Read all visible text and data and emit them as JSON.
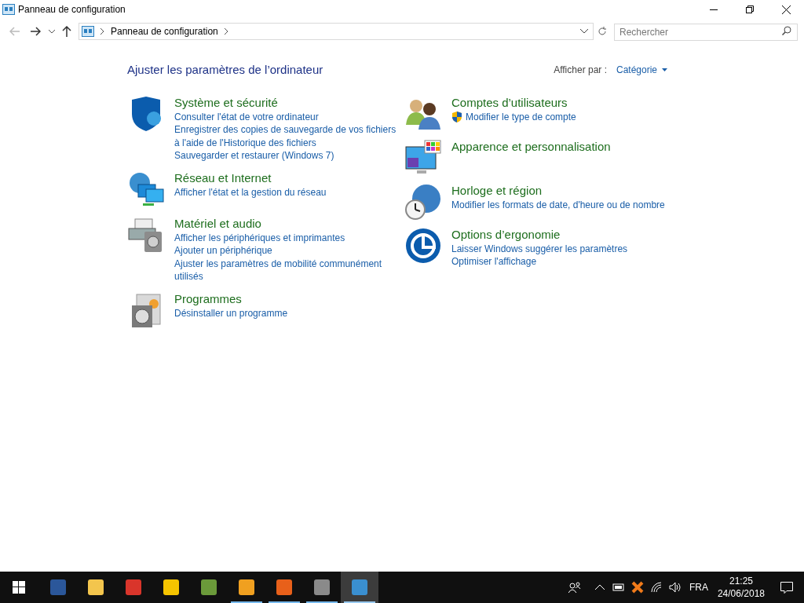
{
  "window": {
    "title": "Panneau de configuration"
  },
  "address_bar": {
    "crumbs": [
      "Panneau de configuration"
    ]
  },
  "search": {
    "placeholder": "Rechercher"
  },
  "heading": "Ajuster les paramètres de l’ordinateur",
  "view_by": {
    "label": "Afficher par :",
    "value": "Catégorie"
  },
  "columns": [
    [
      {
        "title": "Système et sécurité",
        "links": [
          {
            "text": "Consulter l'état de votre ordinateur",
            "kind": "plain"
          },
          {
            "text": "Enregistrer des copies de sauvegarde de vos fichiers à l'aide de l'Historique des fichiers",
            "kind": "plain"
          },
          {
            "text": "Sauvegarder et restaurer (Windows 7)",
            "kind": "plain"
          }
        ]
      },
      {
        "title": "Réseau et Internet",
        "links": [
          {
            "text": "Afficher l'état et la gestion du réseau",
            "kind": "plain"
          }
        ]
      },
      {
        "title": "Matériel et audio",
        "links": [
          {
            "text": "Afficher les périphériques et imprimantes",
            "kind": "plain"
          },
          {
            "text": "Ajouter un périphérique",
            "kind": "plain"
          },
          {
            "text": "Ajuster les paramètres de mobilité communément utilisés",
            "kind": "plain"
          }
        ]
      },
      {
        "title": "Programmes",
        "links": [
          {
            "text": "Désinstaller un programme",
            "kind": "plain"
          }
        ]
      }
    ],
    [
      {
        "title": "Comptes d’utilisateurs",
        "links": [
          {
            "text": "Modifier le type de compte",
            "kind": "admin"
          }
        ]
      },
      {
        "title": "Apparence et personnalisation"
      },
      {
        "title": "Horloge et région",
        "links": [
          {
            "text": "Modifier les formats de date, d'heure ou de nombre",
            "kind": "plain"
          }
        ]
      },
      {
        "title": "Options d’ergonomie",
        "links": [
          {
            "text": "Laisser Windows suggérer les paramètres",
            "kind": "plain"
          },
          {
            "text": "Optimiser l'affichage",
            "kind": "plain"
          }
        ]
      }
    ]
  ],
  "taskbar": {
    "apps": [
      {
        "running": false,
        "selected": false
      },
      {
        "running": false,
        "selected": false
      },
      {
        "running": false,
        "selected": false
      },
      {
        "running": false,
        "selected": false
      },
      {
        "running": false,
        "selected": false
      },
      {
        "running": true,
        "selected": false
      },
      {
        "running": true,
        "selected": false
      },
      {
        "running": true,
        "selected": false
      },
      {
        "running": true,
        "selected": true
      }
    ],
    "language": "FRA",
    "time": "21:25",
    "date": "24/06/2018"
  }
}
